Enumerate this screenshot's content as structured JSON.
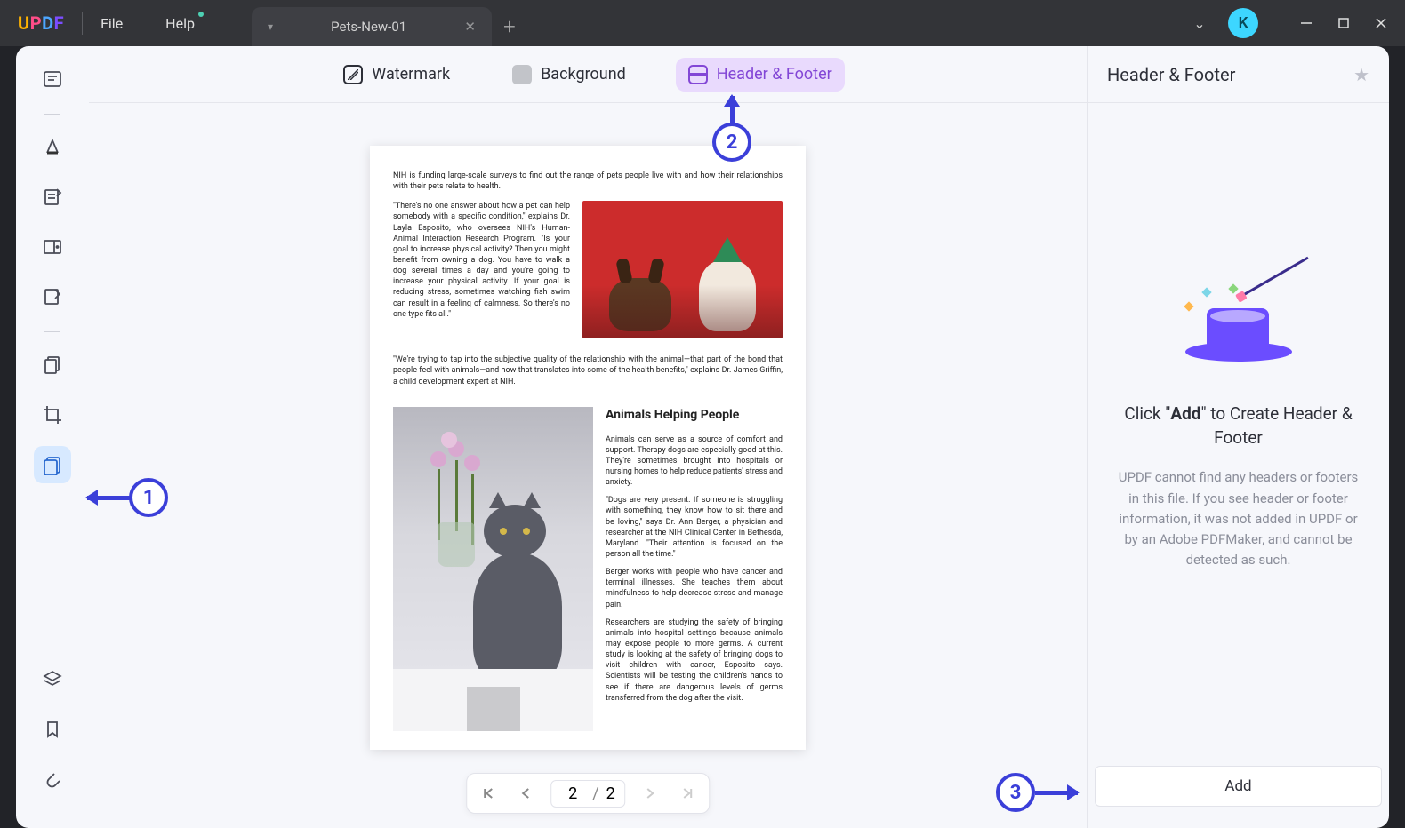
{
  "menu": {
    "file": "File",
    "help": "Help"
  },
  "tab": {
    "title": "Pets-New-01"
  },
  "avatar_letter": "K",
  "top_tabs": {
    "watermark": "Watermark",
    "background": "Background",
    "header_footer": "Header & Footer"
  },
  "doc": {
    "intro": "NIH is funding large-scale surveys to find out the range of pets people live with and how their relationships with their pets relate to health.",
    "quote1": "\"There's no one answer about how a pet can help somebody with a specific condition,\" explains Dr. Layla Esposito, who oversees NIH's Human-Animal Interaction Research Program. \"Is your goal to increase physical activity? Then you might benefit from owning a dog. You have to walk a dog several times a day and you're going to increase your physical activity. If your goal is reducing stress, sometimes watching fish swim can result in a feeling of calmness. So there's no one type fits all.\"",
    "mid": "\"We're trying to tap into the subjective quality of the relationship with the animal—that part of the bond that people feel with animals—and how that translates into some of the health benefits,\" explains Dr. James Griffin, a child development expert at NIH.",
    "heading": "Animals Helping People",
    "p1": "Animals can serve as a source of comfort and support. Therapy dogs are especially good at this. They're sometimes brought into hospitals or nursing homes to help reduce patients' stress and anxiety.",
    "p2": "\"Dogs are very present. If someone is struggling with something, they know how to sit there and be loving,\" says Dr. Ann Berger, a physician and researcher at the NIH Clinical Center in Bethesda, Maryland. \"Their attention is focused on the person all the time.\"",
    "p3": "Berger works with people who have cancer and terminal illnesses. She teaches them about mindfulness to help decrease stress and manage pain.",
    "p4": "Researchers are studying the safety of bringing animals into hospital settings because animals may expose people to more germs. A current study is looking at the safety of bringing dogs to visit children with cancer, Esposito says. Scientists will be testing the children's hands to see if there are dangerous levels of germs transferred from the dog after the visit."
  },
  "page_nav": {
    "current": "2",
    "total": "2"
  },
  "right_panel": {
    "title": "Header & Footer",
    "text_pre": "Click \"",
    "text_bold": "Add",
    "text_post": "\" to Create Header & Footer",
    "desc": "UPDF cannot find any headers or footers in this file. If you see header or footer information, it was not added in UPDF or by an Adobe PDFMaker, and cannot be detected as such.",
    "add_btn": "Add"
  },
  "callouts": {
    "c1": "1",
    "c2": "2",
    "c3": "3"
  }
}
